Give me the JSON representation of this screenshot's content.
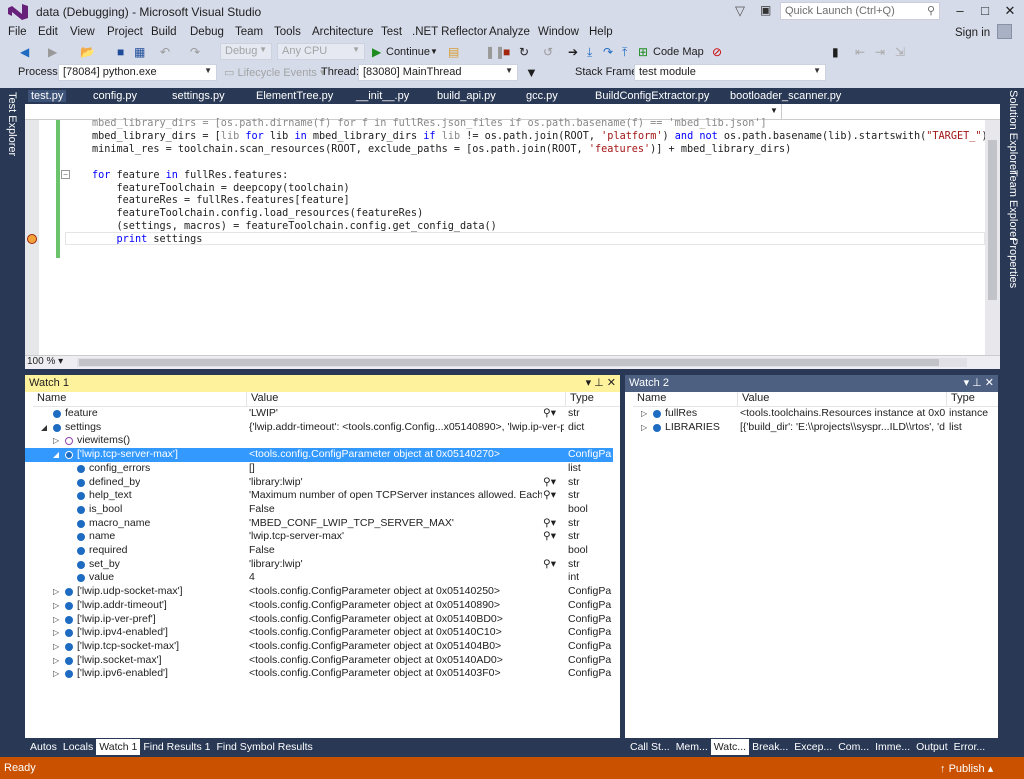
{
  "window": {
    "title": "data (Debugging) - Microsoft Visual Studio",
    "quick_launch_placeholder": "Quick Launch (Ctrl+Q)",
    "sign_in": "Sign in"
  },
  "menu": [
    "File",
    "Edit",
    "View",
    "Project",
    "Build",
    "Debug",
    "Team",
    "Tools",
    "Architecture",
    "Test",
    ".NET Reflector",
    "Analyze",
    "Window",
    "Help"
  ],
  "toolbar": {
    "config": "Debug",
    "platform": "Any CPU",
    "continue": "Continue",
    "code_map": "Code Map"
  },
  "debug_location": {
    "process_label": "Process:",
    "process": "[78084] python.exe",
    "lifecycle": "Lifecycle Events",
    "thread_label": "Thread:",
    "thread": "[83080] MainThread",
    "stack_frame_label": "Stack Frame:",
    "stack_frame": "test module"
  },
  "tabs": [
    "test.py",
    "config.py",
    "settings.py",
    "ElementTree.py",
    "__init__.py",
    "build_api.py",
    "gcc.py",
    "BuildConfigExtractor.py",
    "bootloader_scanner.py"
  ],
  "side_left": [
    "Test Explorer"
  ],
  "side_right": [
    "Solution Explorer",
    "Team Explorer",
    "Properties"
  ],
  "editor": {
    "zoom": "100 %",
    "code": [
      [
        [
          "mbed_library_dirs = [os.path.dirname(f) for f in fullRes.json_files if os.path.basename(f) == 'mbed_lib.json']",
          "dim"
        ]
      ],
      [
        [
          "mbed_library_dirs = [",
          ""
        ],
        [
          "lib",
          "dim"
        ],
        [
          " ",
          ""
        ],
        [
          "for",
          "kw"
        ],
        [
          " lib ",
          ""
        ],
        [
          "in",
          "kw"
        ],
        [
          " mbed_library_dirs ",
          ""
        ],
        [
          "if",
          "kw"
        ],
        [
          " ",
          ""
        ],
        [
          "lib",
          "dim"
        ],
        [
          " != os.path.join(ROOT, ",
          ""
        ],
        [
          "'platform'",
          "str"
        ],
        [
          ") ",
          ""
        ],
        [
          "and not",
          "kw"
        ],
        [
          " os.path.basename(lib).startswith(",
          ""
        ],
        [
          "\"TARGET_\"",
          "str"
        ],
        [
          ")]",
          ""
        ]
      ],
      [
        [
          "minimal_res = toolchain.scan_resources(ROOT, exclude_paths = [os.path.join(ROOT, ",
          ""
        ],
        [
          "'features'",
          "str"
        ],
        [
          ")] + mbed_library_dirs)",
          ""
        ]
      ],
      [
        [
          "",
          ""
        ]
      ],
      [
        [
          "for",
          "kw"
        ],
        [
          " feature ",
          ""
        ],
        [
          "in",
          "kw"
        ],
        [
          " fullRes.features:",
          ""
        ]
      ],
      [
        [
          "    featureToolchain = deepcopy(toolchain)",
          ""
        ]
      ],
      [
        [
          "    featureRes = fullRes.features[feature]",
          ""
        ]
      ],
      [
        [
          "    featureToolchain.config.load_resources(featureRes)",
          ""
        ]
      ],
      [
        [
          "    (settings, macros) = featureToolchain.config.get_config_data()",
          ""
        ]
      ],
      [
        [
          "    ",
          ""
        ],
        [
          "print",
          "kw"
        ],
        [
          " settings",
          ""
        ]
      ]
    ]
  },
  "watch1": {
    "title": "Watch 1",
    "columns": [
      "Name",
      "Value",
      "Type"
    ],
    "rows": [
      {
        "level": 0,
        "exp": "",
        "icon": "field",
        "name": "feature",
        "value": "'LWIP'",
        "type": "str",
        "mag": true
      },
      {
        "level": 0,
        "exp": "open",
        "icon": "field",
        "name": "settings",
        "value": "{'lwip.addr-timeout': <tools.config.Config...x05140890>, 'lwip.ip-ver-pref': ·",
        "type": "dict",
        "mag": false
      },
      {
        "level": 1,
        "exp": "closed",
        "icon": "method",
        "name": "viewitems()",
        "value": "",
        "type": "",
        "mag": false
      },
      {
        "level": 1,
        "exp": "open",
        "icon": "object",
        "name": "['lwip.tcp-server-max']",
        "value": "<tools.config.ConfigParameter object at 0x05140270>",
        "type": "ConfigPa",
        "mag": false,
        "selected": true
      },
      {
        "level": 2,
        "exp": "",
        "icon": "field",
        "name": "config_errors",
        "value": "[]",
        "type": "list",
        "mag": false
      },
      {
        "level": 2,
        "exp": "",
        "icon": "field",
        "name": "defined_by",
        "value": "'library:lwip'",
        "type": "str",
        "mag": true
      },
      {
        "level": 2,
        "exp": "",
        "icon": "field",
        "name": "help_text",
        "value": "'Maximum number of open TCPServer instances allowed.  Each requir",
        "type": "str",
        "mag": true
      },
      {
        "level": 2,
        "exp": "",
        "icon": "field",
        "name": "is_bool",
        "value": "False",
        "type": "bool",
        "mag": false
      },
      {
        "level": 2,
        "exp": "",
        "icon": "field",
        "name": "macro_name",
        "value": "'MBED_CONF_LWIP_TCP_SERVER_MAX'",
        "type": "str",
        "mag": true
      },
      {
        "level": 2,
        "exp": "",
        "icon": "field",
        "name": "name",
        "value": "'lwip.tcp-server-max'",
        "type": "str",
        "mag": true
      },
      {
        "level": 2,
        "exp": "",
        "icon": "field",
        "name": "required",
        "value": "False",
        "type": "bool",
        "mag": false
      },
      {
        "level": 2,
        "exp": "",
        "icon": "field",
        "name": "set_by",
        "value": "'library:lwip'",
        "type": "str",
        "mag": true
      },
      {
        "level": 2,
        "exp": "",
        "icon": "field",
        "name": "value",
        "value": "4",
        "type": "int",
        "mag": false
      },
      {
        "level": 1,
        "exp": "closed",
        "icon": "field",
        "name": "['lwip.udp-socket-max']",
        "value": "<tools.config.ConfigParameter object at 0x05140250>",
        "type": "ConfigPa",
        "mag": false
      },
      {
        "level": 1,
        "exp": "closed",
        "icon": "field",
        "name": "['lwip.addr-timeout']",
        "value": "<tools.config.ConfigParameter object at 0x05140890>",
        "type": "ConfigPa",
        "mag": false
      },
      {
        "level": 1,
        "exp": "closed",
        "icon": "field",
        "name": "['lwip.ip-ver-pref']",
        "value": "<tools.config.ConfigParameter object at 0x05140BD0>",
        "type": "ConfigPa",
        "mag": false
      },
      {
        "level": 1,
        "exp": "closed",
        "icon": "field",
        "name": "['lwip.ipv4-enabled']",
        "value": "<tools.config.ConfigParameter object at 0x05140C10>",
        "type": "ConfigPa",
        "mag": false
      },
      {
        "level": 1,
        "exp": "closed",
        "icon": "field",
        "name": "['lwip.tcp-socket-max']",
        "value": "<tools.config.ConfigParameter object at 0x051404B0>",
        "type": "ConfigPa",
        "mag": false
      },
      {
        "level": 1,
        "exp": "closed",
        "icon": "field",
        "name": "['lwip.socket-max']",
        "value": "<tools.config.ConfigParameter object at 0x05140AD0>",
        "type": "ConfigPa",
        "mag": false
      },
      {
        "level": 1,
        "exp": "closed",
        "icon": "field",
        "name": "['lwip.ipv6-enabled']",
        "value": "<tools.config.ConfigParameter object at 0x051403F0>",
        "type": "ConfigPa",
        "mag": false
      }
    ]
  },
  "watch2": {
    "title": "Watch 2",
    "columns": [
      "Name",
      "Value",
      "Type"
    ],
    "rows": [
      {
        "level": 0,
        "exp": "closed",
        "icon": "field",
        "name": "fullRes",
        "value": "<tools.toolchains.Resources instance at 0x04017l",
        "type": "instance",
        "mag": false
      },
      {
        "level": 0,
        "exp": "closed",
        "icon": "field",
        "name": "LIBRARIES",
        "value": "[{'build_dir': 'E:\\\\projects\\\\syspr...ILD\\\\rtos', 'dep",
        "type": "list",
        "mag": false
      }
    ]
  },
  "bottom_tabs_left": [
    "Autos",
    "Locals",
    "Watch 1",
    "Find Results 1",
    "Find Symbol Results"
  ],
  "bottom_tabs_left_active": "Watch 1",
  "bottom_tabs_right": [
    "Call St...",
    "Mem...",
    "Watc...",
    "Break...",
    "Excep...",
    "Com...",
    "Imme...",
    "Output",
    "Error..."
  ],
  "bottom_tabs_right_active": "Watc...",
  "status": {
    "text": "Ready",
    "publish": "Publish"
  },
  "colors": {
    "status_bar": "#ca5100",
    "watch_header_active": "#fff29d",
    "selection": "#3399ff",
    "frame": "#293955"
  }
}
